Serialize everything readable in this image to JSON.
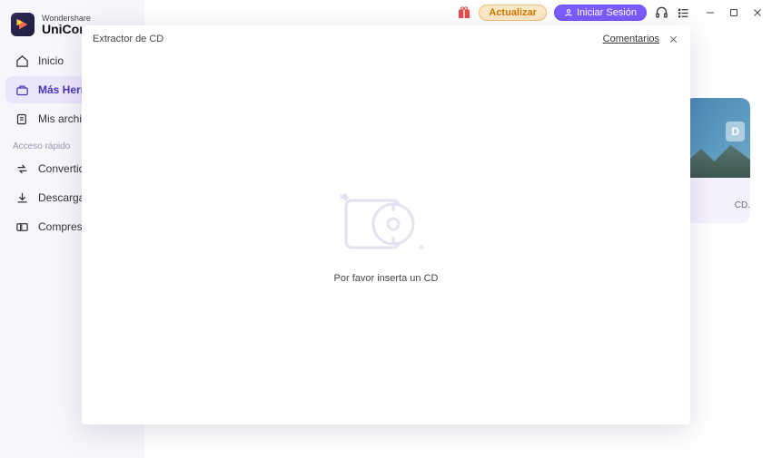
{
  "brand": {
    "sub": "Wondershare",
    "main": "UniCon"
  },
  "topbar": {
    "update_label": "Actualizar",
    "login_label": "Iniciar Sesión"
  },
  "sidebar": {
    "items": [
      {
        "label": "Inicio"
      },
      {
        "label": "Más Herra"
      },
      {
        "label": "Mis archivo"
      }
    ],
    "quick_label": "Acceso rápido",
    "quick_items": [
      {
        "label": "Convertido"
      },
      {
        "label": "Descargado"
      },
      {
        "label": "Compresor"
      }
    ]
  },
  "card": {
    "tag": "D",
    "desc": "CD."
  },
  "modal": {
    "title": "Extractor de CD",
    "feedback": "Comentarios",
    "message": "Por favor inserta un CD"
  }
}
